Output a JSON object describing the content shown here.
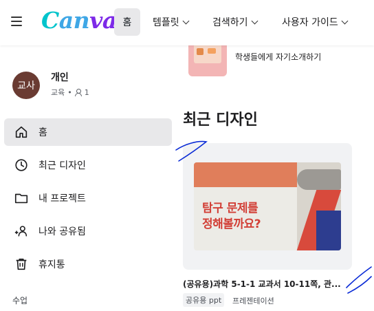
{
  "header": {
    "logo": {
      "c": "C",
      "an": "an",
      "va": "va"
    },
    "nav": {
      "home": "홈",
      "templates": "템플릿",
      "explore": "검색하기",
      "guide": "사용자 가이드"
    }
  },
  "account": {
    "avatar": "교사",
    "name": "개인",
    "type": "교육",
    "separator": "•",
    "members": "1"
  },
  "sidebar": {
    "items": [
      {
        "label": "홈",
        "icon": "home-icon"
      },
      {
        "label": "최근 디자인",
        "icon": "clock-icon"
      },
      {
        "label": "내 프로젝트",
        "icon": "folder-icon"
      },
      {
        "label": "나와 공유됨",
        "icon": "people-icon"
      },
      {
        "label": "휴지통",
        "icon": "trash-icon"
      }
    ],
    "section": "수업"
  },
  "main": {
    "top_card_title": "학생들에게 자기소개하기",
    "recent_title": "최근 디자인",
    "card": {
      "slide_heading_line1": "탐구 문제를",
      "slide_heading_line2": "정해볼까요?",
      "title": "(공유용)과학 5-1-1 교과서 10-11쪽, 관...",
      "tag": "공유용 ppt",
      "type": "프레젠테이션"
    }
  },
  "colors": {
    "accent_active_bg": "#e8e8ea",
    "logo_teal": "#00c4cc",
    "logo_purple": "#7d2ae8",
    "avatar_bg": "#6a3b32",
    "scribble_ink": "#0a2bd6"
  }
}
